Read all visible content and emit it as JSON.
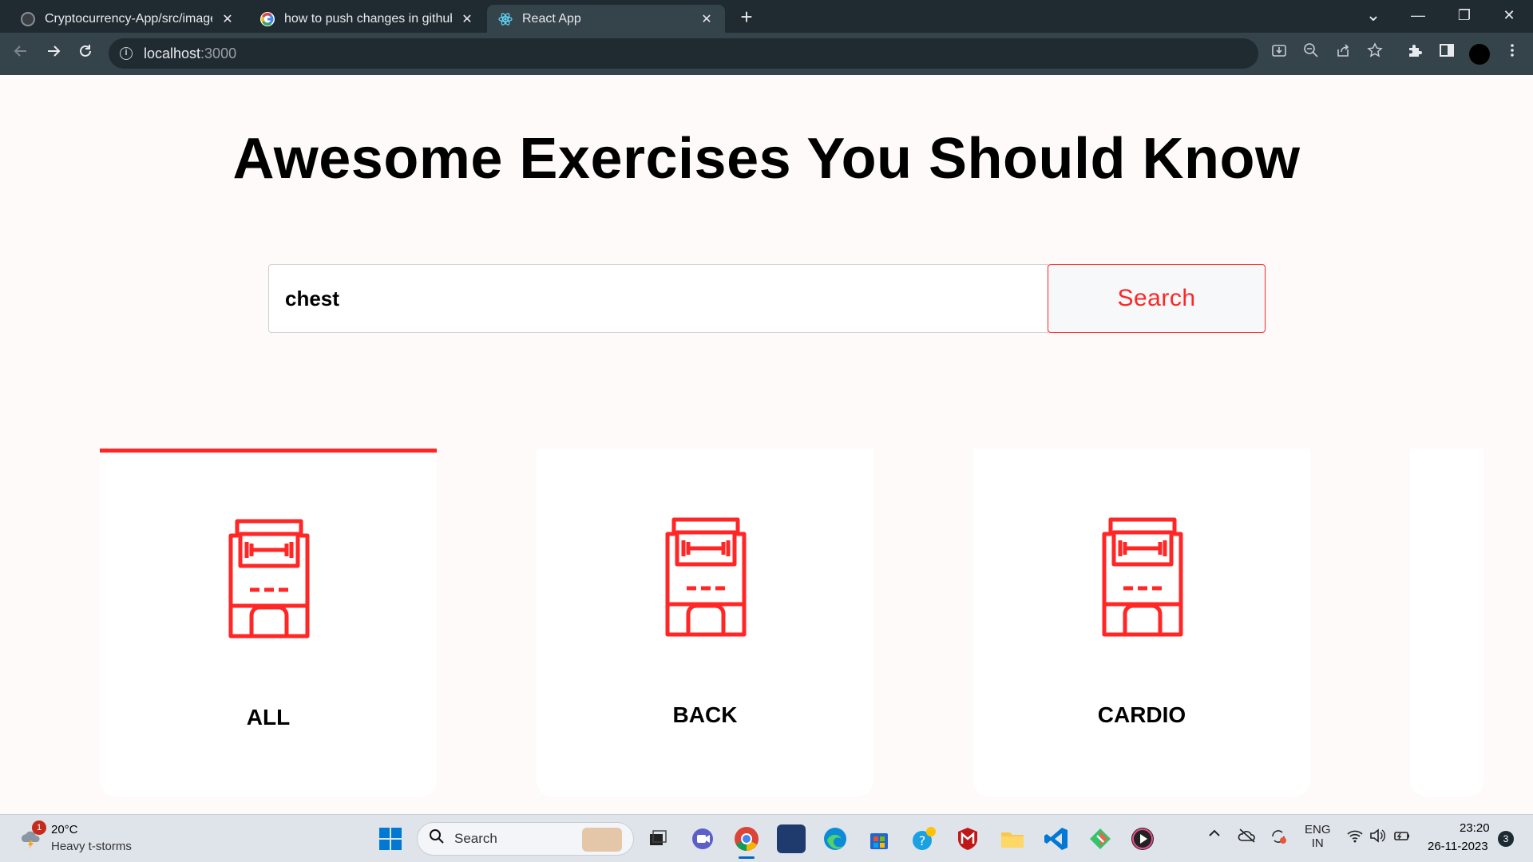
{
  "browser": {
    "tabs": [
      {
        "title": "Cryptocurrency-App/src/images",
        "close": "✕"
      },
      {
        "title": "how to push changes in github",
        "close": "✕"
      },
      {
        "title": "React App",
        "close": "✕"
      }
    ],
    "new_tab": "+",
    "window_controls": {
      "minimize": "—",
      "restore": "❐",
      "close": "✕",
      "tab_search": "⌄"
    },
    "address_host": "localhost",
    "address_port": ":3000",
    "colors": {
      "tabstrip": "#202b31",
      "toolbar": "#35434b"
    }
  },
  "page": {
    "headline": "Awesome Exercises You Should Know",
    "search": {
      "value": "chest",
      "button_label": "Search"
    },
    "accent_color": "#ff2625",
    "categories": [
      {
        "label": "ALL",
        "selected": true,
        "icon": "gym-icon"
      },
      {
        "label": "BACK",
        "selected": false,
        "icon": "gym-icon"
      },
      {
        "label": "CARDIO",
        "selected": false,
        "icon": "gym-icon"
      }
    ]
  },
  "taskbar": {
    "weather": {
      "temp": "20°C",
      "desc": "Heavy t-storms",
      "badge": "1"
    },
    "search_placeholder": "Search",
    "language_line1": "ENG",
    "language_line2": "IN",
    "time": "23:20",
    "date": "26-11-2023",
    "notifications": "3"
  }
}
